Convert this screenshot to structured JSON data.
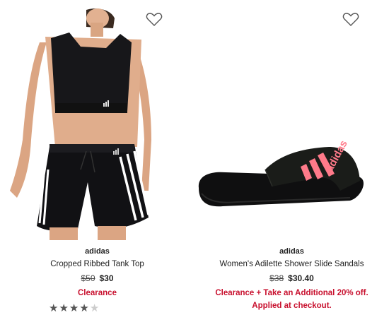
{
  "products": [
    {
      "brand": "adidas",
      "name": "Cropped Ribbed Tank Top",
      "was_price": "$50",
      "price": "$30",
      "promo": "Clearance",
      "rating_stars": 4,
      "rating_max": 5,
      "favorite_icon": "heart-outline-icon"
    },
    {
      "brand": "adidas",
      "name": "Women's Adilette Shower Slide Sandals",
      "was_price": "$38",
      "price": "$30.40",
      "promo_line1": "Clearance + Take an Additional 20% off.",
      "promo_line2": "Applied at checkout.",
      "favorite_icon": "heart-outline-icon",
      "logo_text": "adidas"
    }
  ],
  "colors": {
    "promo": "#c8102e",
    "star_filled": "#555555",
    "star_empty": "#cccccc",
    "slide_accent": "#ff7a8a"
  }
}
